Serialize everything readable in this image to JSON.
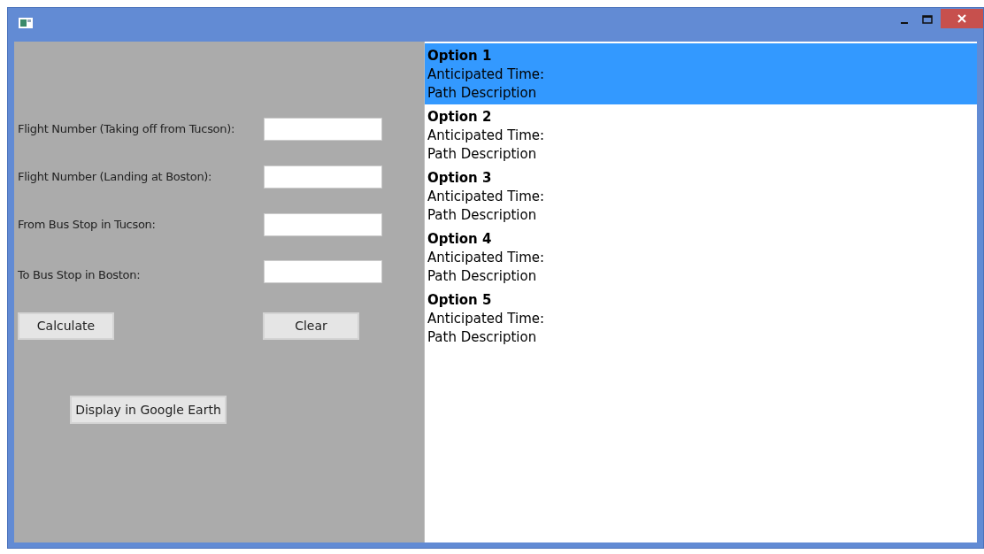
{
  "form": {
    "fields": [
      {
        "label": "Flight Number (Taking off from Tucson):"
      },
      {
        "label": "Flight Number (Landing at Boston):"
      },
      {
        "label": "From Bus Stop in Tucson:"
      },
      {
        "label": "To Bus Stop in Boston:"
      }
    ],
    "buttons": [
      "Calculate",
      "Clear"
    ],
    "earth_button": "Display in Google Earth"
  },
  "options": [
    {
      "title": "Option 1",
      "time": "Anticipated Time:",
      "description": "Path Description",
      "selected": true
    },
    {
      "title": "Option 2",
      "time": "Anticipated Time:",
      "description": "Path Description",
      "selected": false
    },
    {
      "title": "Option 3",
      "time": "Anticipated Time:",
      "description": "Path Description",
      "selected": false
    },
    {
      "title": "Option 4",
      "time": "Anticipated Time:",
      "description": "Path Description",
      "selected": false
    },
    {
      "title": "Option 5",
      "time": "Anticipated Time:",
      "description": "Path Description",
      "selected": false
    }
  ]
}
